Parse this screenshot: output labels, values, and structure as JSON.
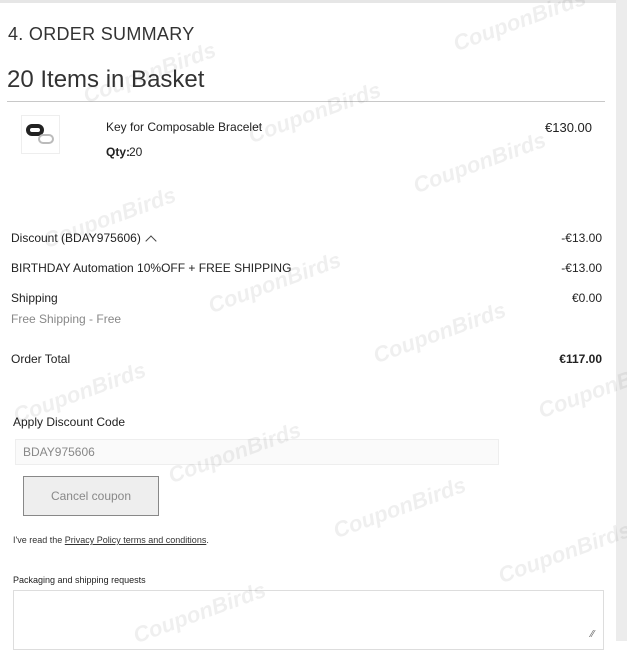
{
  "checkout": {
    "step_title": "4. ORDER SUMMARY",
    "basket_title": "20 Items in Basket"
  },
  "item": {
    "name": "Key for Composable Bracelet",
    "qty_label": "Qty:",
    "qty_value": "20",
    "price": "€130.00",
    "image_icon": "bracelet-key-thumbnail"
  },
  "totals": {
    "discount_label": "Discount (BDAY975606)",
    "discount_value": "-€13.00",
    "promo_label": "BIRTHDAY Automation 10%OFF + FREE SHIPPING",
    "promo_value": "-€13.00",
    "shipping_label": "Shipping",
    "shipping_value": "€0.00",
    "shipping_method": "Free Shipping - Free",
    "order_total_label": "Order Total",
    "order_total_value": "€117.00"
  },
  "discount_form": {
    "heading": "Apply Discount Code",
    "code_value": "BDAY975606",
    "cancel_label": "Cancel coupon"
  },
  "privacy": {
    "prefix": "I've read the",
    "link_text": "Privacy Policy terms and conditions",
    "suffix": "."
  },
  "packaging": {
    "label": "Packaging and shipping requests",
    "value": ""
  },
  "watermark": {
    "text": "CouponBirds"
  }
}
